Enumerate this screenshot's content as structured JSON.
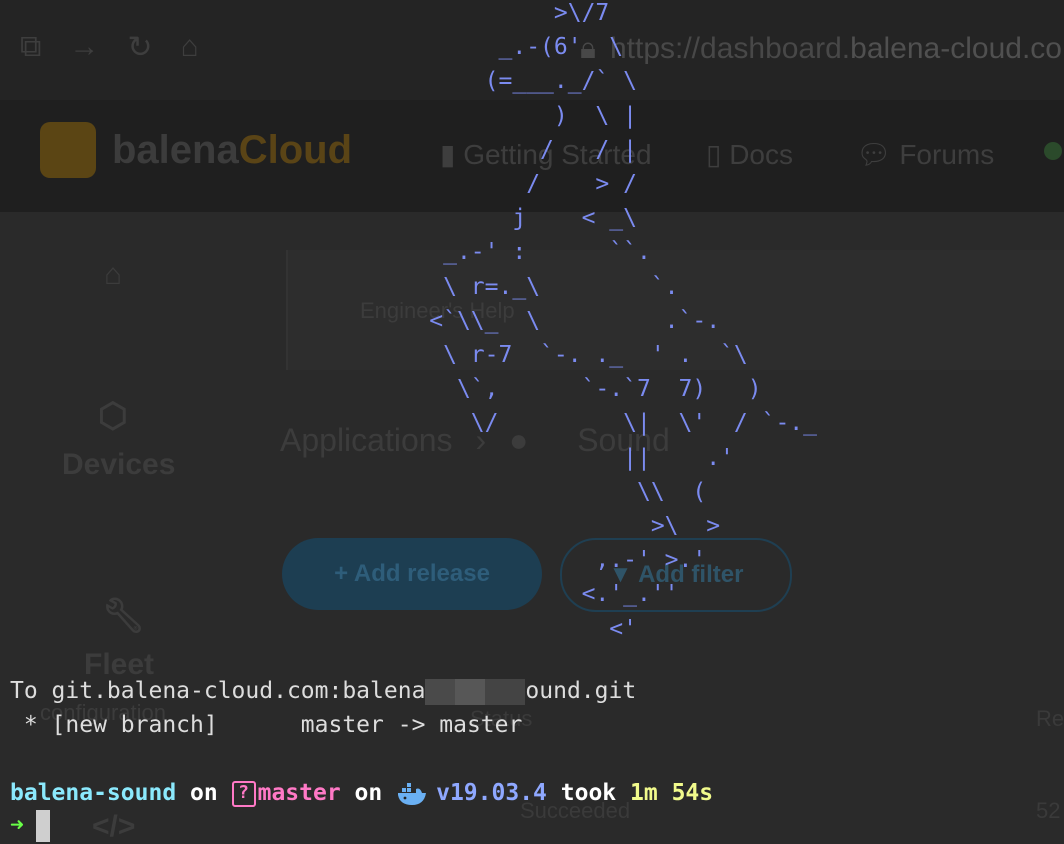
{
  "background": {
    "url": "https://dashboard.balena-cloud.com",
    "url_prefix": "https://dashboard.",
    "url_domain": "balena-cloud.com",
    "logo_a": "balena",
    "logo_b": "Cloud",
    "menu": [
      "Getting Started",
      "Docs",
      "Forums"
    ],
    "side": [
      "Devices",
      "Fleet",
      "configuration"
    ],
    "panel_text": "Engineer's Help",
    "breadcrumb_root": "Applications",
    "breadcrumb_sep": "›",
    "breadcrumb_app": "Sound",
    "add_release": "Add release",
    "add_filter": "Add filter",
    "col_status": "Status",
    "col_rel": "Re",
    "status_value": "Succeeded",
    "num": "52"
  },
  "terminal": {
    "ascii_art": "                                        >\\/7\n                                    _.-(6'  \\\n                                   (=___._/` \\\n                                        )  \\ |\n                                       /   / |\n                                      /    > /\n                                     j    < _\\\n                                _.-' :      ``.\n                                \\ r=._\\        `.\n                               <`\\\\_  \\         .`-.\n                                \\ r-7  `-. ._  ' .  `\\\n                                 \\`,      `-.`7  7)   )\n                                  \\/         \\|  \\'  / `-._\n                                             ||    .'\n                                              \\\\  (\n                                               >\\  >\n                                           ,.-' >.'\n                                          <.'_.''\n                                            <'",
    "push_to_prefix": "To git.balena-cloud.com:balena",
    "push_to_suffix": "ound.git",
    "branch_line": " * [new branch]      master -> master",
    "prompt_dir": "balena-sound",
    "on1": "on",
    "branch_icon": "?",
    "branch": "master",
    "on2": "on",
    "docker_version": "v19.03.4",
    "took": "took",
    "duration_min": "1m",
    "duration_sec": "54s",
    "prompt_arrow": "➜"
  }
}
